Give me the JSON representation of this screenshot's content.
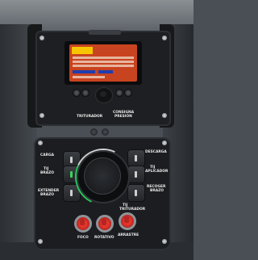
{
  "display": {
    "badge": "",
    "brand_plate": ""
  },
  "upper_labels": {
    "left": "TRITURADOR",
    "right_line1": "CONSIGNA",
    "right_line2": "PRESIÓN"
  },
  "panel_labels": {
    "carga": "CARGA",
    "tij_brazo_1": "TIJ",
    "tij_brazo_2": "BRAZO",
    "extender_1": "EXTENDER",
    "extender_2": "BRAZO",
    "descarga": "DESCARGA",
    "tij_aplicador_1": "TIJ",
    "tij_aplicador_2": "APLICADOR",
    "recoger_1": "RECOGER",
    "recoger_2": "BRAZO",
    "tij_triturador_1": "TIJ",
    "tij_triturador_2": "TRITURADOR",
    "foco": "FOCO",
    "rotativo": "ROTATIVO",
    "arrastre": "ARRASTRE"
  },
  "colors": {
    "screen": "#c8431f",
    "accent_green": "#27c75a",
    "toggle_red": "#e3352c"
  }
}
